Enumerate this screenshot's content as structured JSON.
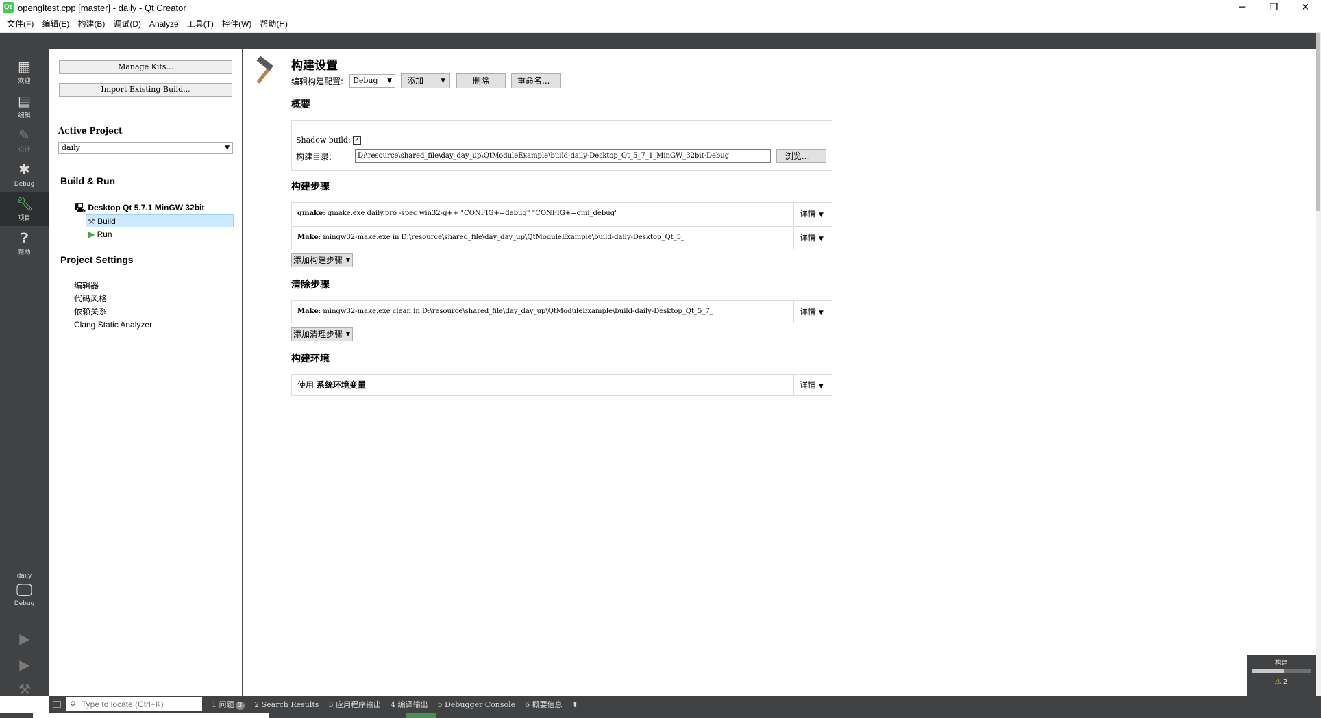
{
  "window": {
    "title": "opengltest.cpp [master] - daily - Qt Creator",
    "icon_text": "Qt",
    "minimize": "─",
    "restore": "❐",
    "close": "✕"
  },
  "menu": [
    "文件(F)",
    "编辑(E)",
    "构建(B)",
    "调试(D)",
    "Analyze",
    "工具(T)",
    "控件(W)",
    "帮助(H)"
  ],
  "modes": [
    {
      "label": "欢迎",
      "icon": "grid-icon"
    },
    {
      "label": "编辑",
      "icon": "edit-icon"
    },
    {
      "label": "设计",
      "icon": "pencil-icon"
    },
    {
      "label": "Debug",
      "icon": "bug-icon"
    },
    {
      "label": "项目",
      "icon": "wrench-icon"
    },
    {
      "label": "帮助",
      "icon": "help-icon"
    }
  ],
  "kit_selector": {
    "project": "daily",
    "config": "Debug"
  },
  "nav": {
    "manage_kits": "Manage Kits...",
    "import_build": "Import Existing Build...",
    "active_project_heading": "Active Project",
    "active_project_value": "daily",
    "build_run_heading": "Build & Run",
    "kit_name": "Desktop Qt 5.7.1 MinGW 32bit",
    "build_item": "Build",
    "run_item": "Run",
    "project_settings_heading": "Project Settings",
    "settings_items": [
      "编辑器",
      "代码风格",
      "依赖关系",
      "Clang Static Analyzer"
    ]
  },
  "main": {
    "title": "构建设置",
    "edit_config_label": "编辑构建配置:",
    "config_value": "Debug",
    "add_button": "添加",
    "delete_button": "删除",
    "rename_button": "重命名...",
    "overview_heading": "概要",
    "shadow_build_label": "Shadow build:",
    "shadow_build_checked": true,
    "build_dir_label": "构建目录:",
    "build_dir_value": "D:\\resource\\shared_file\\day_day_up\\QtModuleExample\\build-daily-Desktop_Qt_5_7_1_MinGW_32bit-Debug",
    "browse_button": "浏览...",
    "build_steps_heading": "构建步骤",
    "build_steps": [
      {
        "name": "qmake",
        "text": ": qmake.exe daily.pro -spec win32-g++ \"CONFIG+=debug\" \"CONFIG+=qml_debug\"",
        "details": "详情"
      },
      {
        "name": "Make",
        "text": ": mingw32-make.exe in D:\\resource\\shared_file\\day_day_up\\QtModuleExample\\build-daily-Desktop_Qt_5_",
        "details": "详情"
      }
    ],
    "add_build_step": "添加构建步骤",
    "clean_steps_heading": "清除步骤",
    "clean_steps": [
      {
        "name": "Make",
        "text": ": mingw32-make.exe clean in D:\\resource\\shared_file\\day_day_up\\QtModuleExample\\build-daily-Desktop_Qt_5_7_",
        "details": "详情"
      }
    ],
    "add_clean_step": "添加清理步骤",
    "env_heading": "构建环境",
    "env_prefix": "使用",
    "env_value": "系统环境变量",
    "env_details": "详情"
  },
  "build_progress": {
    "label": "构建",
    "fraction": 0.55,
    "warnings": "2"
  },
  "output_bar": {
    "locator_placeholder": "Type to locate (Ctrl+K)",
    "panes": [
      {
        "label": "1  问题",
        "badge": "3"
      },
      {
        "label": "2  Search Results"
      },
      {
        "label": "3  应用程序输出"
      },
      {
        "label": "4  编译输出"
      },
      {
        "label": "5  Debugger Console"
      },
      {
        "label": "6  概要信息"
      }
    ]
  }
}
